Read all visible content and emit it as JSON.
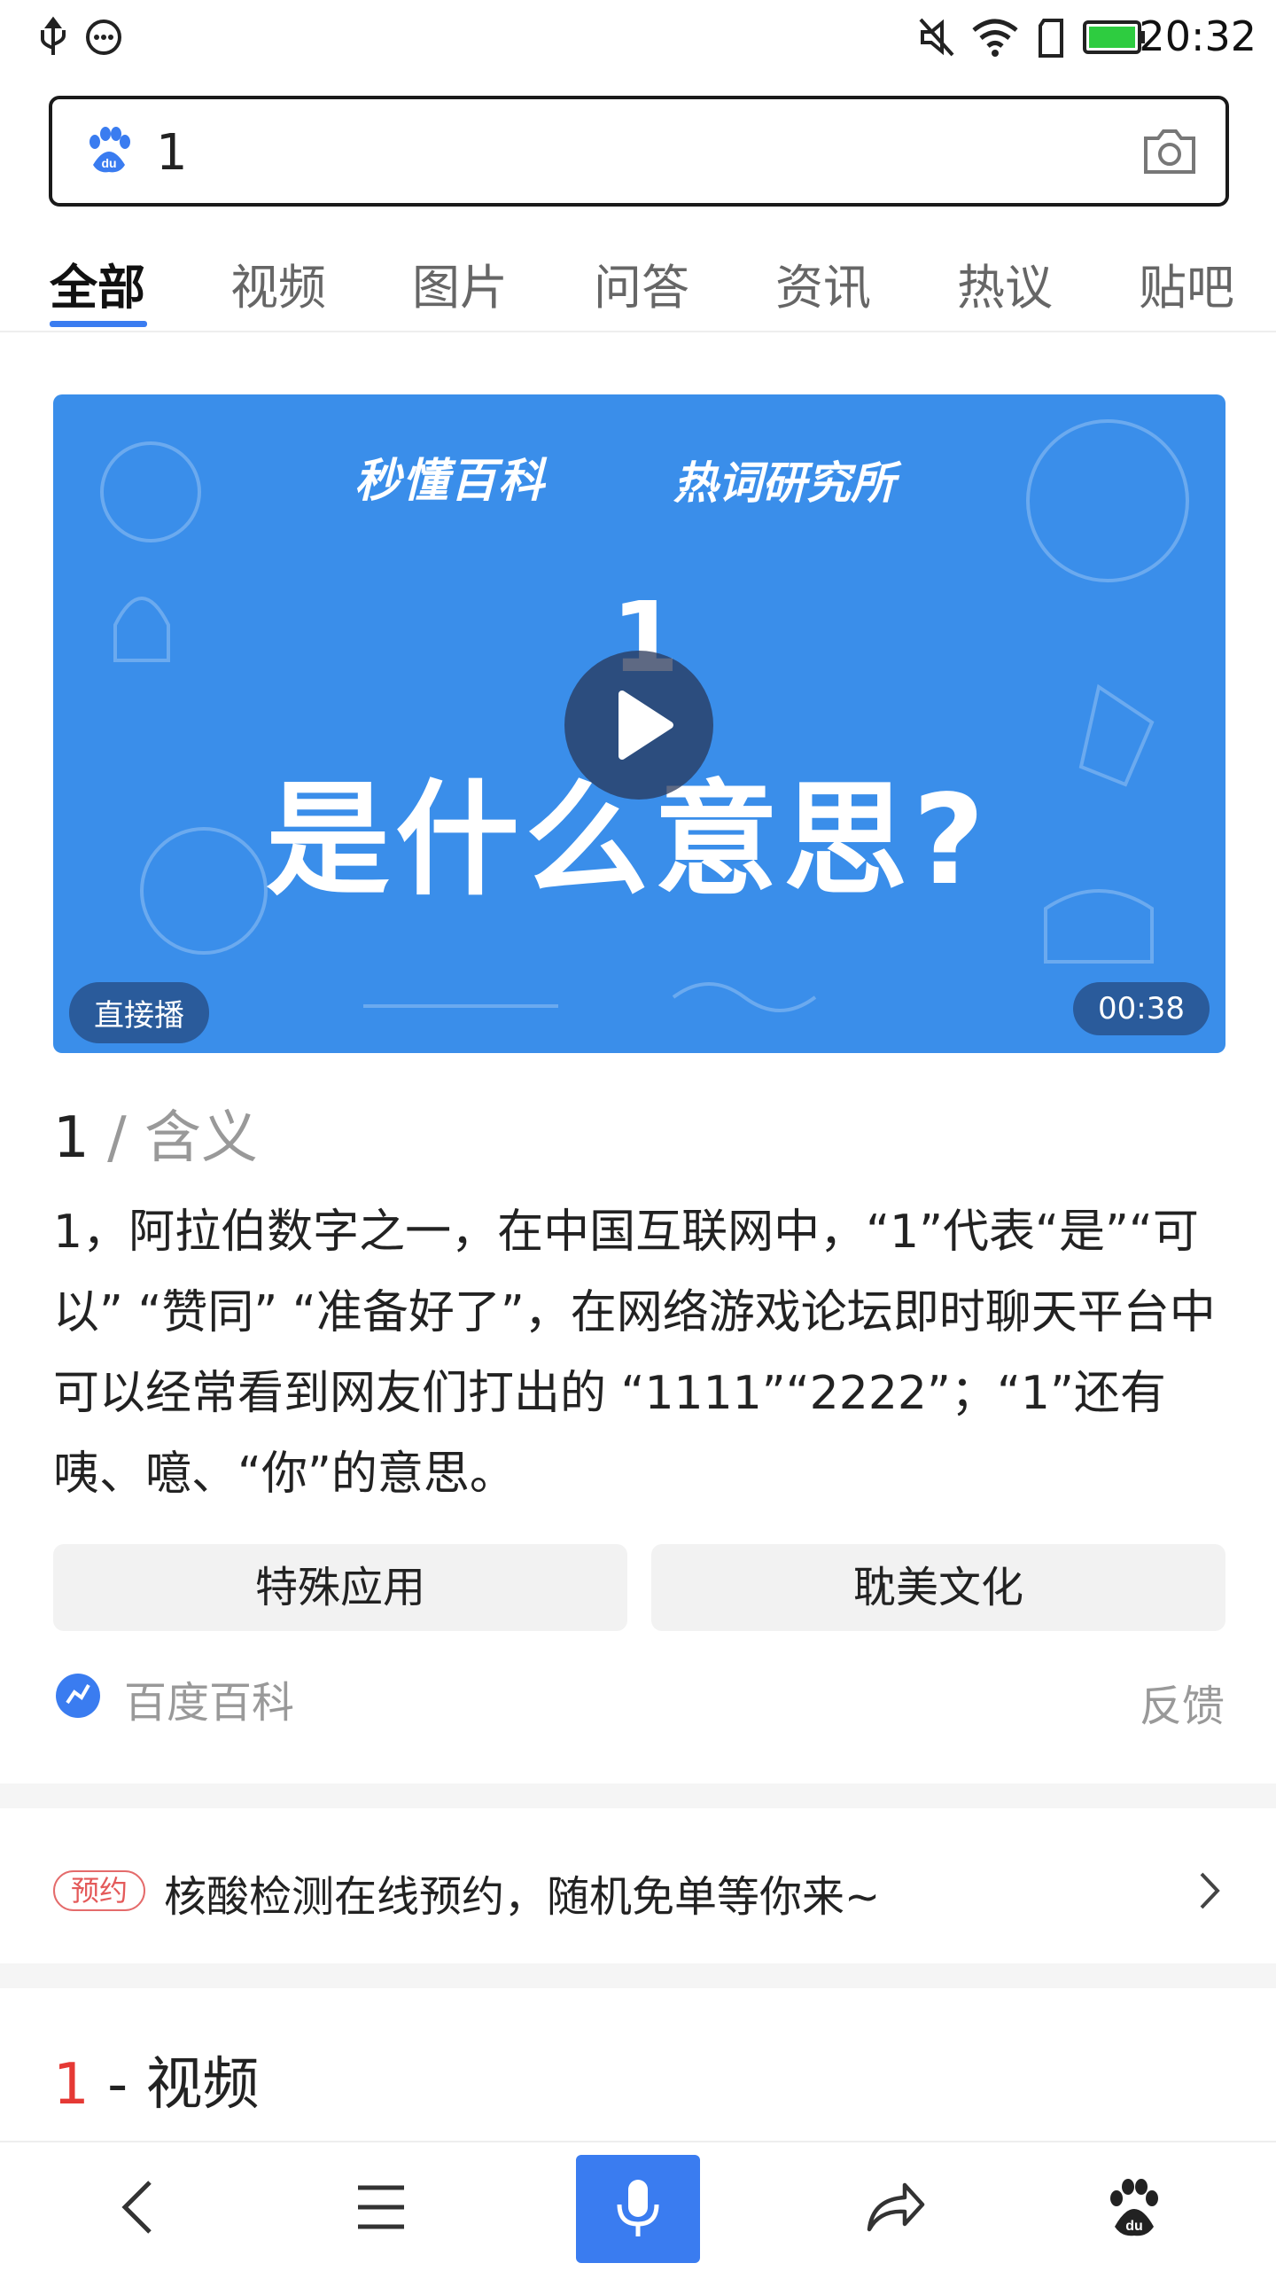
{
  "status_bar": {
    "time": "20:32"
  },
  "search": {
    "value": "1"
  },
  "tabs": [
    {
      "label": "全部"
    },
    {
      "label": "视频"
    },
    {
      "label": "图片"
    },
    {
      "label": "问答"
    },
    {
      "label": "资讯"
    },
    {
      "label": "热议"
    },
    {
      "label": "贴吧"
    }
  ],
  "video": {
    "brand": "秒懂百科",
    "brand_sub": "热词研究所",
    "big_number": "1",
    "big_text": "是什么意思?",
    "badge_left": "直接播",
    "duration": "00:38",
    "bg_color": "#3a8eea"
  },
  "result": {
    "title_term": "1",
    "title_sep": " / ",
    "title_aspect": "含义",
    "description": "1，阿拉伯数字之一，在中国互联网中，“1”代表“是”“可以” “赞同” “准备好了”，在网络游戏论坛即时聊天平台中可以经常看到网友们打出的 “1111”“2222”；“1”还有咦、噫、“你”的意思。",
    "pills": [
      "特殊应用",
      "耽美文化"
    ],
    "source": "百度百科",
    "feedback": "反馈"
  },
  "promo": {
    "tag": "预约",
    "text": "核酸检测在线预约，随机免单等你来~"
  },
  "section": {
    "num": "1",
    "rest": " - 视频"
  },
  "accent": "#3a7cf0"
}
